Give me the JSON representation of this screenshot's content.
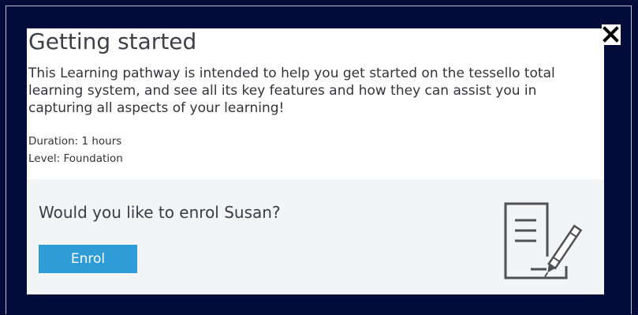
{
  "modal": {
    "title": "Getting started",
    "description": "This Learning pathway is intended to help you get started on the tessello total learning system, and see all its key features and how they can assist you in capturing all aspects of your learning!",
    "duration": "Duration: 1 hours",
    "level": "Level: Foundation"
  },
  "enrol": {
    "question": "Would you like to enrol Susan?",
    "button_label": "Enrol"
  },
  "icons": {
    "close": "close-icon",
    "document": "document-pen-icon"
  },
  "colors": {
    "backdrop": "#020b3a",
    "accent": "#2e9cd6",
    "panel": "#f3f4f6"
  }
}
